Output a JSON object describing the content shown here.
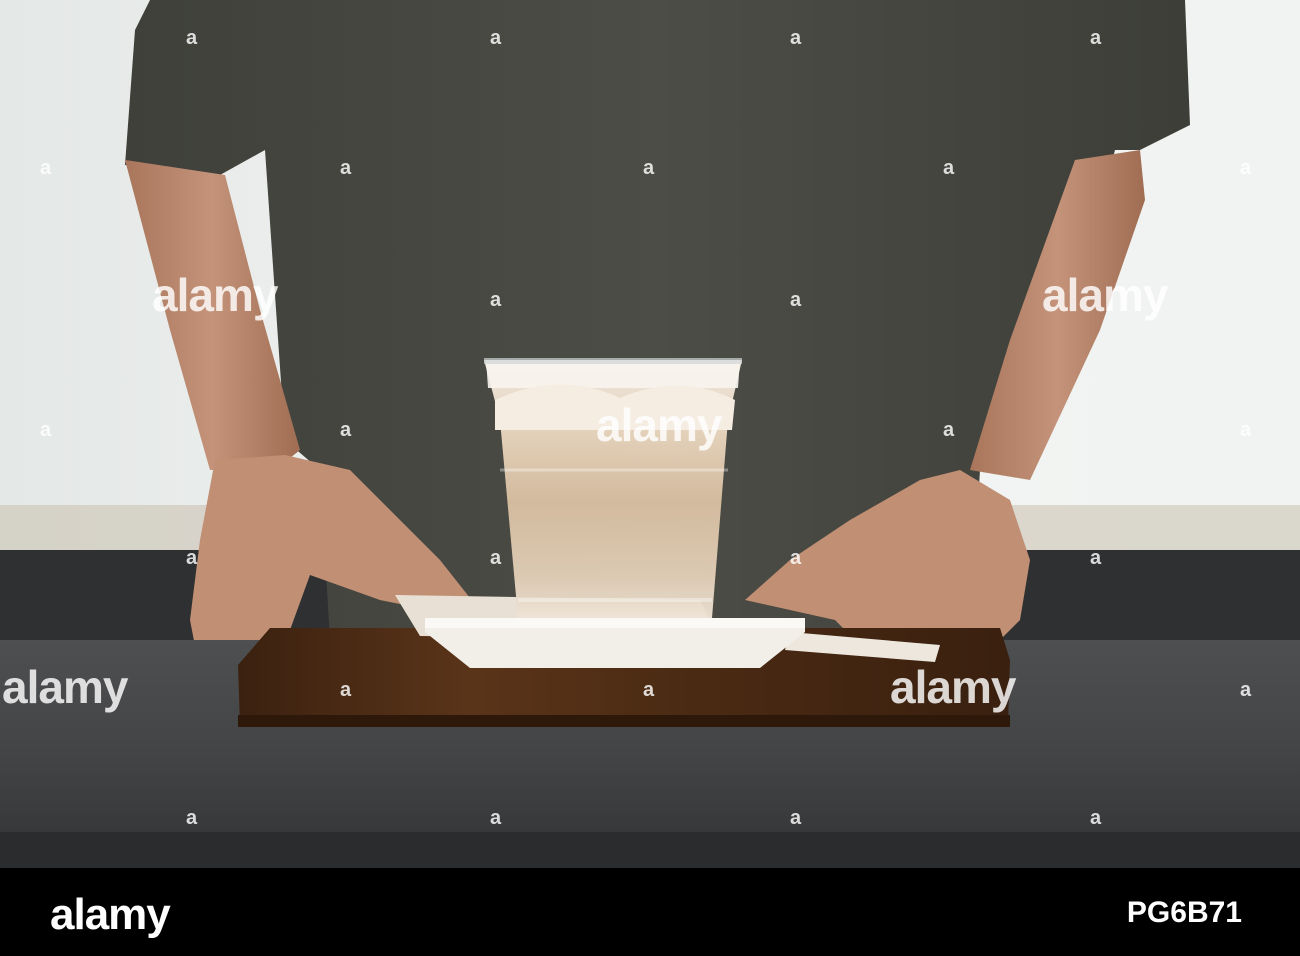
{
  "watermark": {
    "text": "alamy",
    "mark": "a"
  },
  "footer": {
    "logo": "alamy",
    "image_id": "PG6B71"
  },
  "colors": {
    "background": "#e9ecea",
    "shirt": "#474841",
    "skin": "#bd8c72",
    "counter": "#3f4042",
    "tray": "#4a2a14",
    "saucer": "#f2efe9",
    "coffee": "#d9c3a8",
    "foam": "#f4ede3",
    "footer": "#000000"
  }
}
